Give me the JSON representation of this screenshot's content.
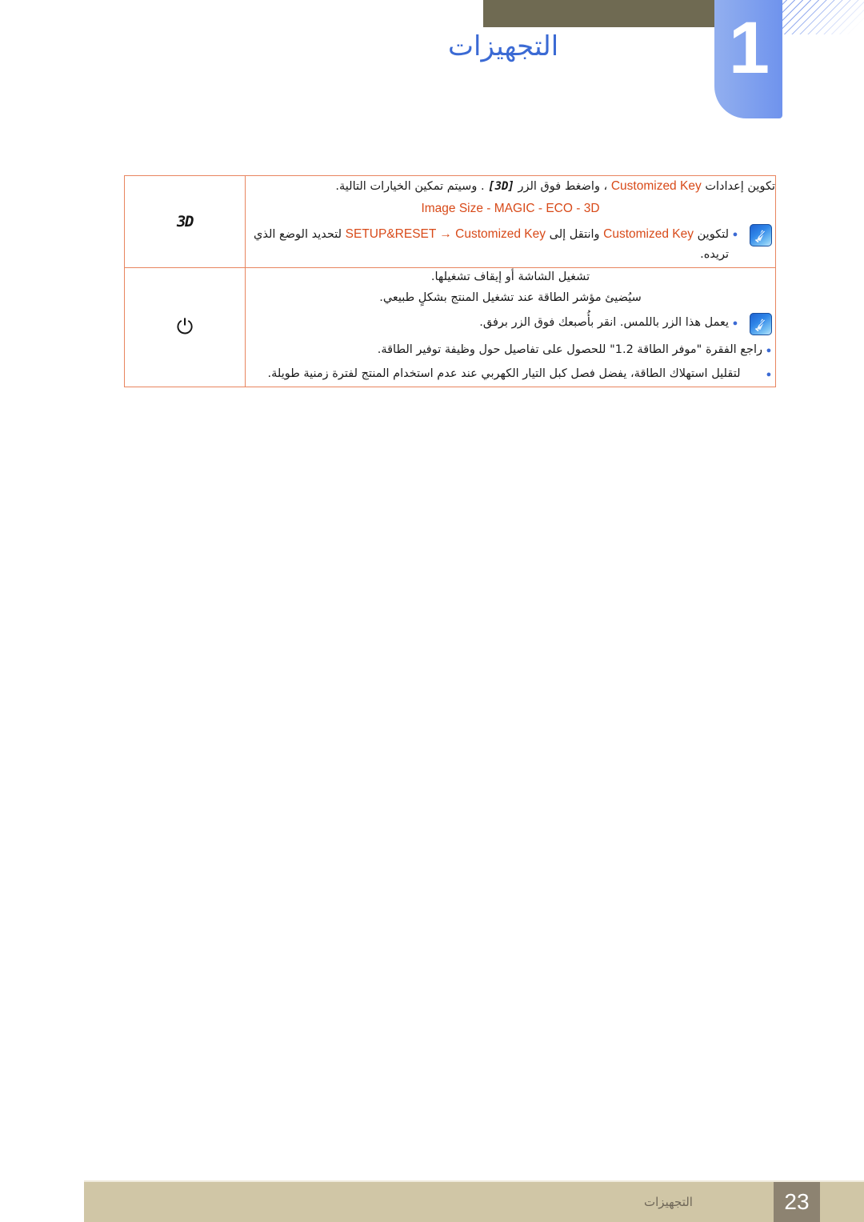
{
  "header": {
    "chapter_number": "1",
    "chapter_title": "التجهيزات"
  },
  "table": {
    "rows": [
      {
        "icon_label": "3D",
        "icon_kind": "3d-glyph",
        "lines": {
          "intro_before": "تكوين إعدادات",
          "intro_en": "Customized Key",
          "intro_mid": "، واضغط فوق الزر",
          "intro_button": "[3D]",
          "intro_after": ". وسيتم تمكين الخيارات التالية.",
          "options_en": "Image Size - MAGIC - ECO - 3D",
          "bullet_ar_1": "لتكوين",
          "bullet_en_1": "Customized Key",
          "bullet_ar_2": "وانتقل إلى",
          "bullet_path": "SETUP&RESET → Customized Key",
          "bullet_tail": "لتحديد الوضع الذي تريده."
        }
      },
      {
        "icon_label": "⏻",
        "icon_kind": "power-glyph",
        "lines": {
          "p1": "تشغيل الشاشة أو إيقاف تشغيلها.",
          "p2": "سيُضيئ مؤشر الطاقة عند تشغيل المنتج بشكلٍ طبيعي.",
          "b1": "يعمل هذا الزر باللمس. انقر بأُصبعك فوق الزر برفق.",
          "b2": "راجع الفقرة \"موفر الطاقة 1.2\" للحصول على تفاصيل حول وظيفة توفير الطاقة.",
          "b3": "لتقليل استهلاك الطاقة، يفضل فصل كبل التيار الكهربي عند عدم استخدام المنتج لفترة زمنية طويلة."
        }
      }
    ]
  },
  "footer": {
    "section_label": "التجهيزات",
    "page_number": "23"
  },
  "colors": {
    "chapter_blue": "#3b6ad4",
    "badge_blue": "#7fa0ee",
    "header_bar": "#6f6a52",
    "accent_orange": "#d84a19",
    "table_border_outer": "#8a7a21",
    "table_border_inner": "#e8855f",
    "footer_tan": "#d0c6a6",
    "footer_page_box": "#8d8371"
  }
}
